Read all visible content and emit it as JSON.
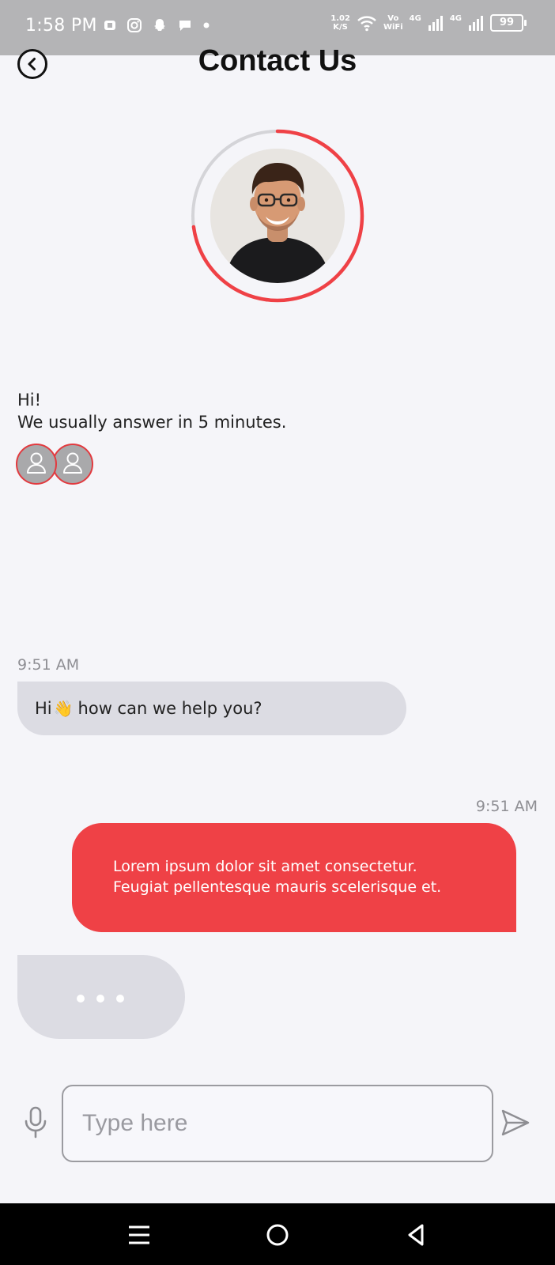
{
  "status_bar": {
    "time": "1:58 PM",
    "net_speed_value": "1.02",
    "net_speed_unit": "K/S",
    "vo": "Vo",
    "wifi": "WiFi",
    "net_type_1": "4G",
    "net_type_2": "4G",
    "battery": "99"
  },
  "header": {
    "title": "Contact Us"
  },
  "greeting": {
    "line1": "Hi!",
    "line2": "We usually answer in 5 minutes."
  },
  "messages": [
    {
      "time": "9:51 AM",
      "text_before": "Hi",
      "emoji": "👋",
      "text_after": " how can we help you?"
    },
    {
      "time": "9:51 AM",
      "line1": "Lorem ipsum dolor sit amet consectetur.",
      "line2": "Feugiat pellentesque mauris scelerisque et."
    }
  ],
  "composer": {
    "placeholder": "Type here"
  },
  "colors": {
    "accent": "#ef4146",
    "incoming_bubble": "#dcdce3",
    "background": "#f5f5f9"
  }
}
